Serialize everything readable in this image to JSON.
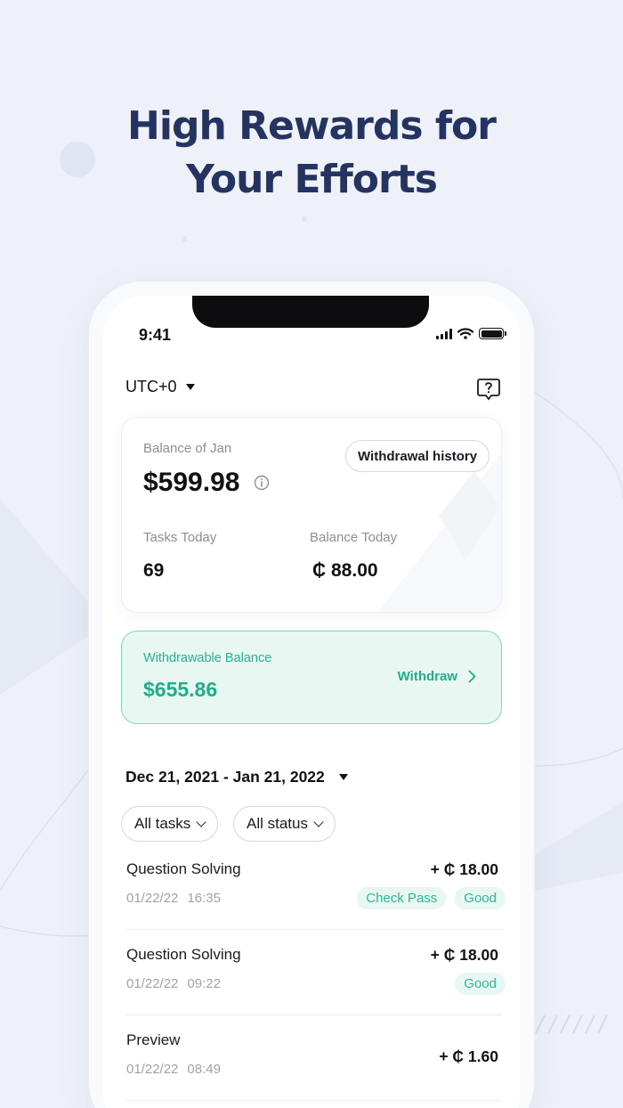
{
  "headline": {
    "line1": "High Rewards for",
    "line2": "Your Efforts"
  },
  "status_bar": {
    "time": "9:41"
  },
  "header": {
    "timezone": "UTC+0"
  },
  "balance_card": {
    "label": "Balance of Jan",
    "amount": "$599.98",
    "history_button": "Withdrawal history",
    "tasks_label": "Tasks Today",
    "tasks_value": "69",
    "balance_today_label": "Balance Today",
    "balance_today_value": "₵ 88.00"
  },
  "withdrawable": {
    "label": "Withdrawable Balance",
    "amount": "$655.86",
    "button": "Withdraw"
  },
  "filters": {
    "date_range": "Dec 21, 2021 - Jan 21, 2022",
    "tasks": "All tasks",
    "status": "All status"
  },
  "transactions": [
    {
      "name": "Question Solving",
      "date": "01/22/22",
      "time": "16:35",
      "amount": "+ ₵ 18.00",
      "badges": [
        "Check Pass",
        "Good"
      ]
    },
    {
      "name": "Question Solving",
      "date": "01/22/22",
      "time": "09:22",
      "amount": "+ ₵ 18.00",
      "badges": [
        "Good"
      ]
    },
    {
      "name": "Preview",
      "date": "01/22/22",
      "time": "08:49",
      "amount": "+ ₵ 1.60",
      "badges": []
    }
  ],
  "colors": {
    "accent": "#1fae88",
    "headline": "#24335f",
    "background": "#eef1f8"
  }
}
